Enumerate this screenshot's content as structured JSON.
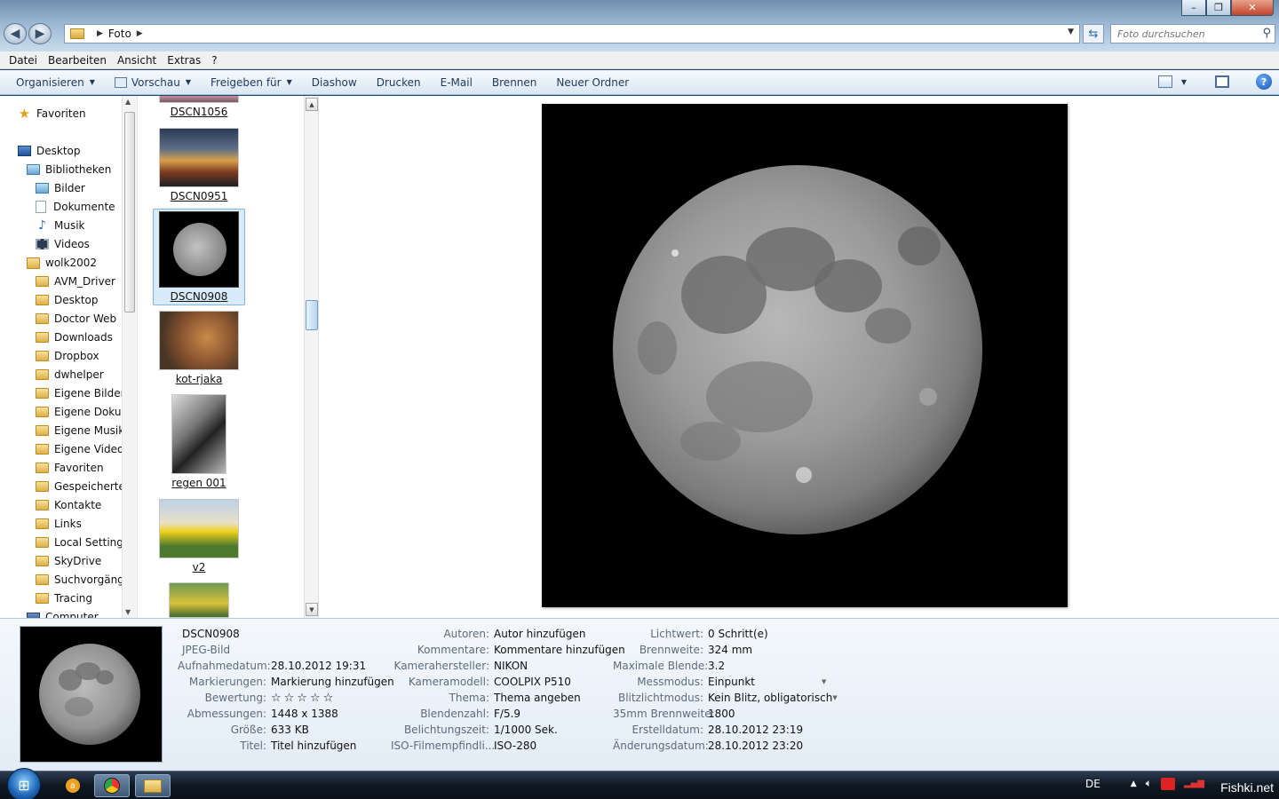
{
  "address": {
    "crumb": "Foto"
  },
  "search": {
    "placeholder": "Foto durchsuchen"
  },
  "menubar": [
    "Datei",
    "Bearbeiten",
    "Ansicht",
    "Extras",
    "?"
  ],
  "commandbar": {
    "organize": "Organisieren",
    "preview": "Vorschau",
    "share": "Freigeben für",
    "slideshow": "Diashow",
    "print": "Drucken",
    "email": "E-Mail",
    "burn": "Brennen",
    "new_folder": "Neuer Ordner"
  },
  "nav": {
    "favorites": "Favoriten",
    "desktop": "Desktop",
    "libraries": "Bibliotheken",
    "lib_items": [
      "Bilder",
      "Dokumente",
      "Musik",
      "Videos"
    ],
    "user": "wolk2002",
    "user_folders": [
      "AVM_Driver",
      "Desktop",
      "Doctor Web",
      "Downloads",
      "Dropbox",
      "dwhelper",
      "Eigene Bilder",
      "Eigene Dokum",
      "Eigene Musik",
      "Eigene Videos",
      "Favoriten",
      "Gespeicherte S",
      "Kontakte",
      "Links",
      "Local Settings",
      "SkyDrive",
      "Suchvorgänge",
      "Tracing"
    ],
    "computer": "Computer"
  },
  "files": [
    "DSCN1056",
    "DSCN0951",
    "DSCN0908",
    "kot-rjaka",
    "regen 001",
    "v2"
  ],
  "details": {
    "name": "DSCN0908",
    "type": "JPEG-Bild",
    "col1": [
      {
        "label": "Aufnahmedatum:",
        "value": "28.10.2012 19:31"
      },
      {
        "label": "Markierungen:",
        "value": "Markierung hinzufügen"
      },
      {
        "label": "Bewertung:",
        "value": "☆☆☆☆☆"
      },
      {
        "label": "Abmessungen:",
        "value": "1448 x 1388"
      },
      {
        "label": "Größe:",
        "value": "633 KB"
      },
      {
        "label": "Titel:",
        "value": "Titel hinzufügen"
      }
    ],
    "col2": [
      {
        "label": "Autoren:",
        "value": "Autor hinzufügen"
      },
      {
        "label": "Kommentare:",
        "value": "Kommentare hinzufügen"
      },
      {
        "label": "Kamerahersteller:",
        "value": "NIKON"
      },
      {
        "label": "Kameramodell:",
        "value": "COOLPIX P510"
      },
      {
        "label": "Thema:",
        "value": "Thema angeben"
      },
      {
        "label": "Blendenzahl:",
        "value": "F/5.9"
      },
      {
        "label": "Belichtungszeit:",
        "value": "1/1000 Sek."
      },
      {
        "label": "ISO-Filmempfindli...",
        "value": "ISO-280"
      }
    ],
    "col3": [
      {
        "label": "Lichtwert:",
        "value": "0 Schritt(e)"
      },
      {
        "label": "Brennweite:",
        "value": "324 mm"
      },
      {
        "label": "Maximale Blende:",
        "value": "3.2"
      },
      {
        "label": "Messmodus:",
        "value": "Einpunkt"
      },
      {
        "label": "Blitzlichtmodus:",
        "value": "Kein Blitz, obligatorisch"
      },
      {
        "label": "35mm Brennweite:",
        "value": "1800"
      },
      {
        "label": "Erstelldatum:",
        "value": "28.10.2012 23:19"
      },
      {
        "label": "Änderungsdatum:",
        "value": "28.10.2012 23:20"
      }
    ]
  },
  "taskbar": {
    "lang": "DE",
    "watermark": "Fishki.net"
  },
  "colors": {
    "accent": "#1b4a78",
    "selection": "#d9eaf9"
  }
}
